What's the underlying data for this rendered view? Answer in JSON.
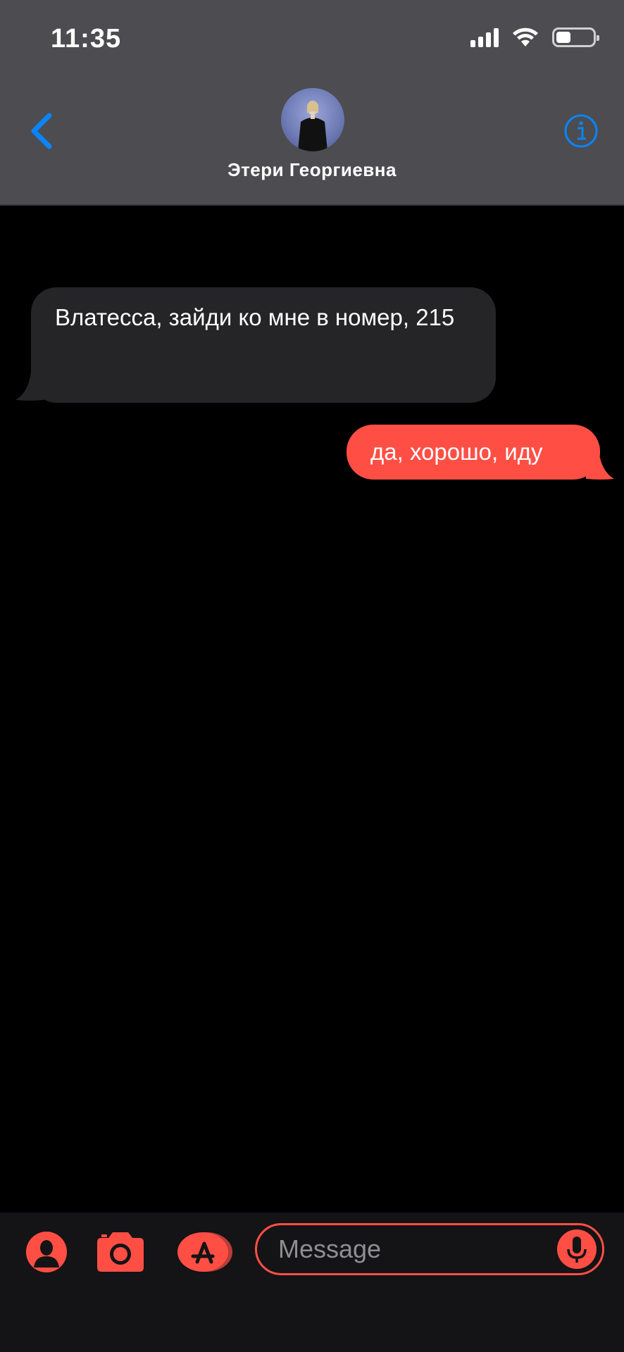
{
  "status_bar": {
    "time": "11:35",
    "battery_level": 0.4,
    "signal_bars": 4
  },
  "header": {
    "contact_name": "Этери Георгиевна",
    "back_icon": "chevron-left-icon",
    "info_icon": "info-circle-icon"
  },
  "messages": [
    {
      "direction": "incoming",
      "text": "Влатесса, зайди ко мне в номер, 215"
    },
    {
      "direction": "outgoing",
      "text": "да, хорошо, иду"
    }
  ],
  "input_bar": {
    "placeholder": "Message",
    "icons": [
      "contact-icon",
      "camera-icon",
      "app-store-icon",
      "microphone-icon"
    ]
  },
  "colors": {
    "accent": "#ff4f45",
    "header_bg": "#4d4c50",
    "incoming_bubble": "#252427",
    "link_blue": "#0a84ff"
  }
}
